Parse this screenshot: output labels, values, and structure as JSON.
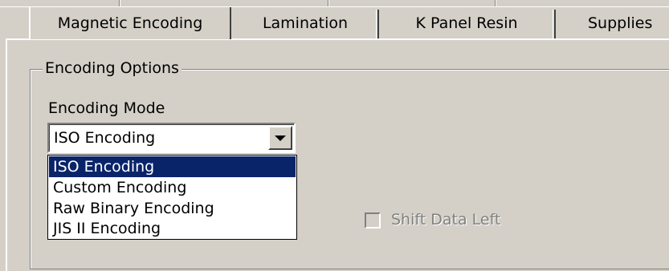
{
  "tabs": [
    {
      "label": "Magnetic Encoding",
      "active": true
    },
    {
      "label": "Lamination",
      "active": false
    },
    {
      "label": "K Panel Resin",
      "active": false
    },
    {
      "label": "Supplies",
      "active": false
    }
  ],
  "group": {
    "label": "Encoding Options"
  },
  "encoding_mode": {
    "label": "Encoding Mode",
    "value": "ISO Encoding",
    "options": [
      "ISO Encoding",
      "Custom Encoding",
      "Raw Binary Encoding",
      "JIS II Encoding"
    ],
    "highlighted": "ISO Encoding"
  },
  "shift_data_left": {
    "label": "Shift Data Left",
    "checked": false,
    "enabled": false
  },
  "colors": {
    "highlight": "#0a246a",
    "face": "#d4d0c8"
  },
  "icons": {
    "dropdown": "chevron-down-icon"
  }
}
